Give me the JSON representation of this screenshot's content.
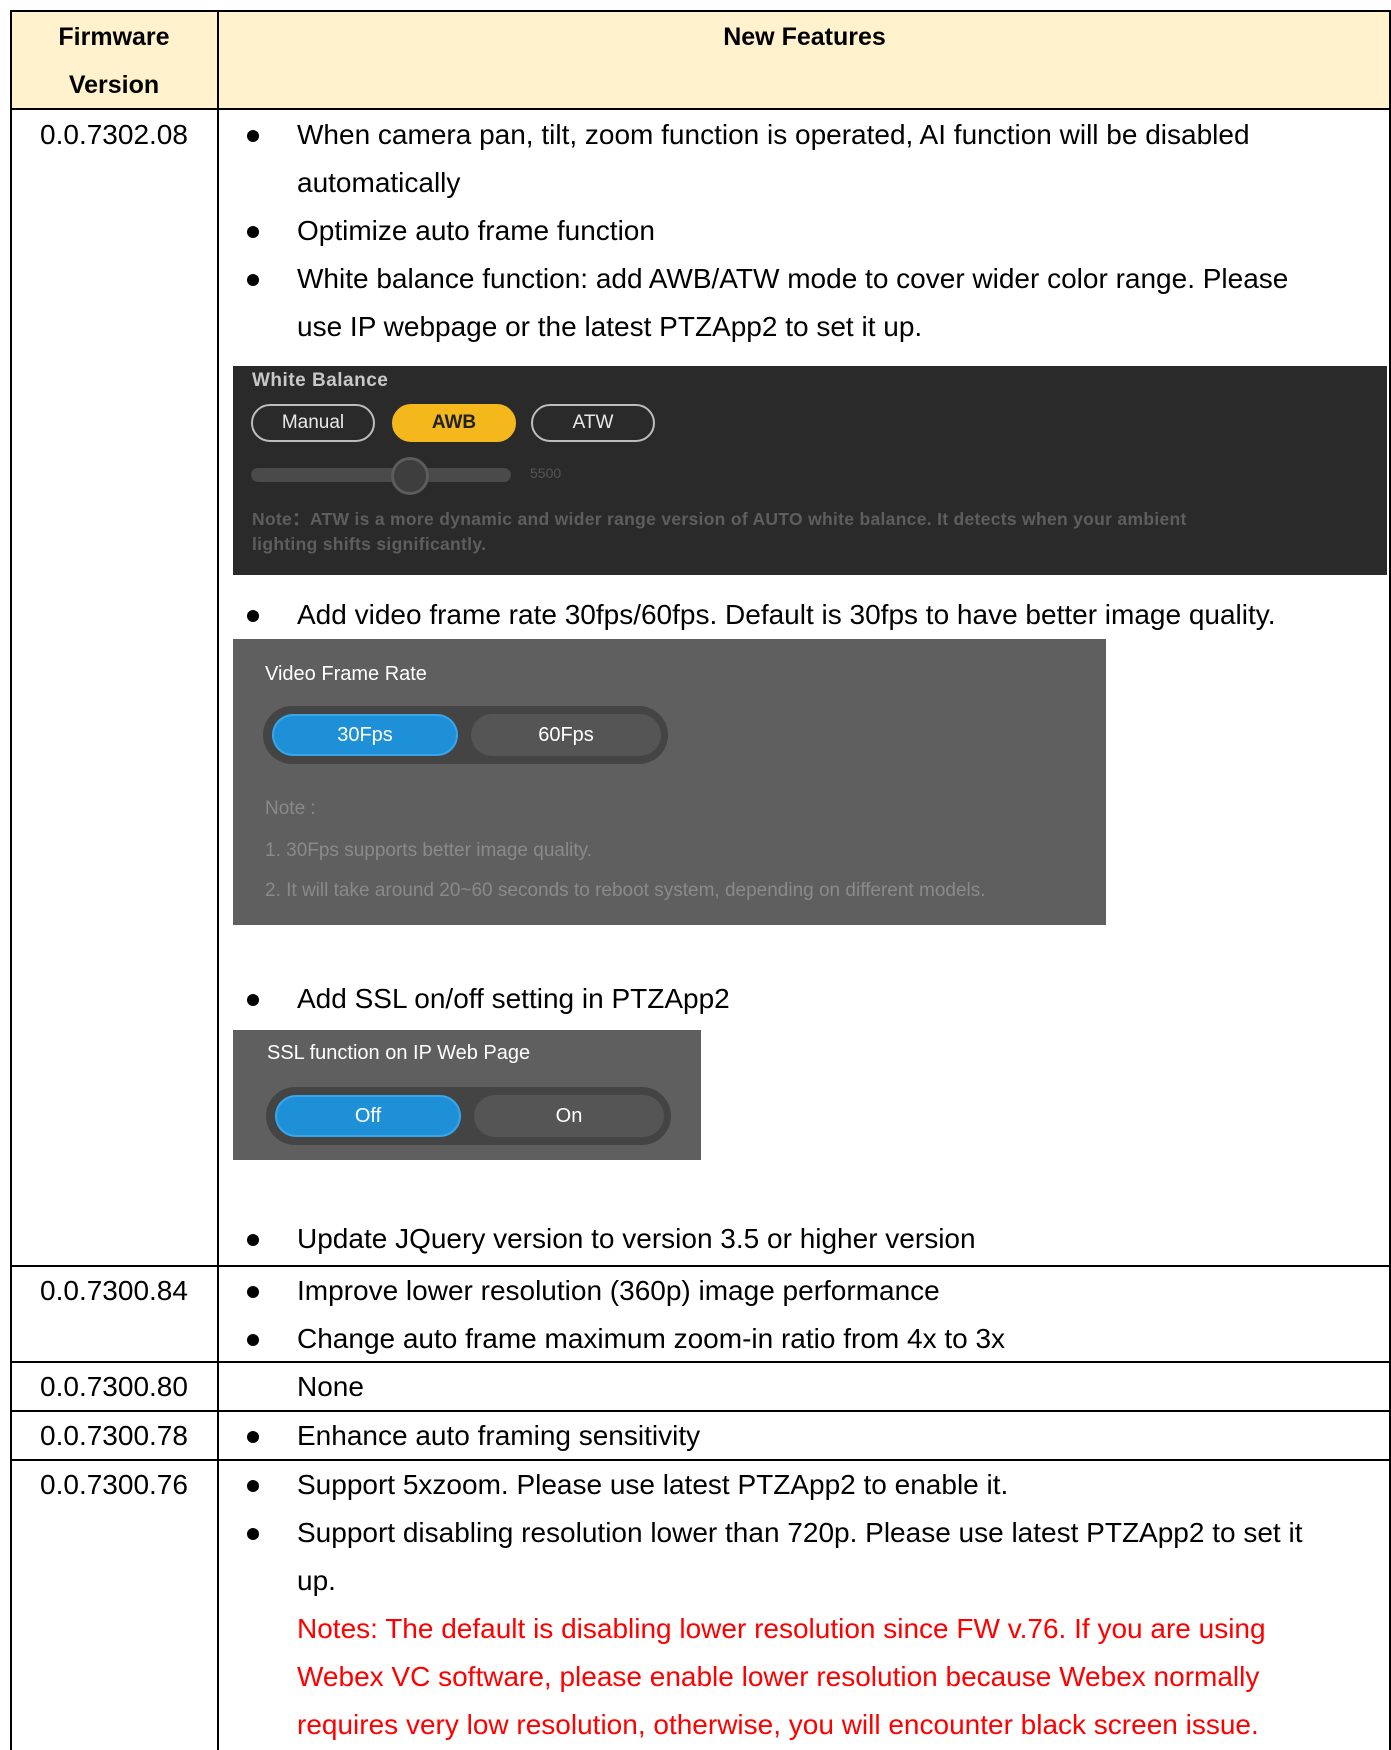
{
  "header": {
    "firmware_version": "Firmware\nVersion",
    "firmware_line1": "Firmware",
    "firmware_line2": "Version",
    "new_features": "New Features"
  },
  "rows": [
    {
      "version": "0.0.7302.08",
      "features": [
        "When camera pan, tilt, zoom function is operated, AI function will be disabled",
        "automatically",
        "Optimize auto frame function",
        "White balance function: add AWB/ATW mode to cover wider color range. Please",
        "use IP webpage or the latest PTZApp2 to set it up.",
        "Add video frame rate 30fps/60fps. Default is 30fps to have better image quality.",
        "Add SSL on/off setting in PTZApp2",
        "Update JQuery version to version 3.5 or higher version"
      ]
    },
    {
      "version": "0.0.7300.84",
      "features": [
        "Improve lower resolution (360p) image performance",
        "Change auto frame maximum zoom-in ratio from 4x to 3x"
      ]
    },
    {
      "version": "0.0.7300.80",
      "features": [
        "None"
      ]
    },
    {
      "version": "0.0.7300.78",
      "features": [
        "Enhance auto framing sensitivity"
      ]
    },
    {
      "version": "0.0.7300.76",
      "features": [
        "Support 5xzoom. Please use latest PTZApp2 to enable it.",
        "Support disabling resolution lower than 720p. Please use latest PTZApp2 to set it",
        "up."
      ],
      "notes": [
        "Notes: The default is disabling lower resolution since FW v.76. If you are using",
        "Webex VC software, please enable lower resolution because Webex normally",
        "requires very low resolution, otherwise, you will encounter black screen issue."
      ]
    }
  ],
  "white_balance_panel": {
    "title": "White Balance",
    "modes": [
      "Manual",
      "AWB",
      "ATW"
    ],
    "selected": "AWB",
    "slider_value": "5500",
    "note_line1": "Note：ATW is a more dynamic and wider range version of AUTO white balance. It detects when your ambient",
    "note_line2": "lighting shifts significantly."
  },
  "frame_rate_panel": {
    "title": "Video Frame Rate",
    "options": [
      "30Fps",
      "60Fps"
    ],
    "selected": "30Fps",
    "note_title": "Note :",
    "note_1": "1. 30Fps supports better image quality.",
    "note_2": "2. It will take around 20~60 seconds to reboot system, depending on different models."
  },
  "ssl_panel": {
    "title": "SSL function on IP Web Page",
    "options": [
      "Off",
      "On"
    ],
    "selected": "Off"
  },
  "colors": {
    "header_bg": "#fff2cc",
    "notes_red": "#ff0000",
    "awb_yellow": "#f5b81c",
    "toggle_blue": "#1e90d8"
  }
}
